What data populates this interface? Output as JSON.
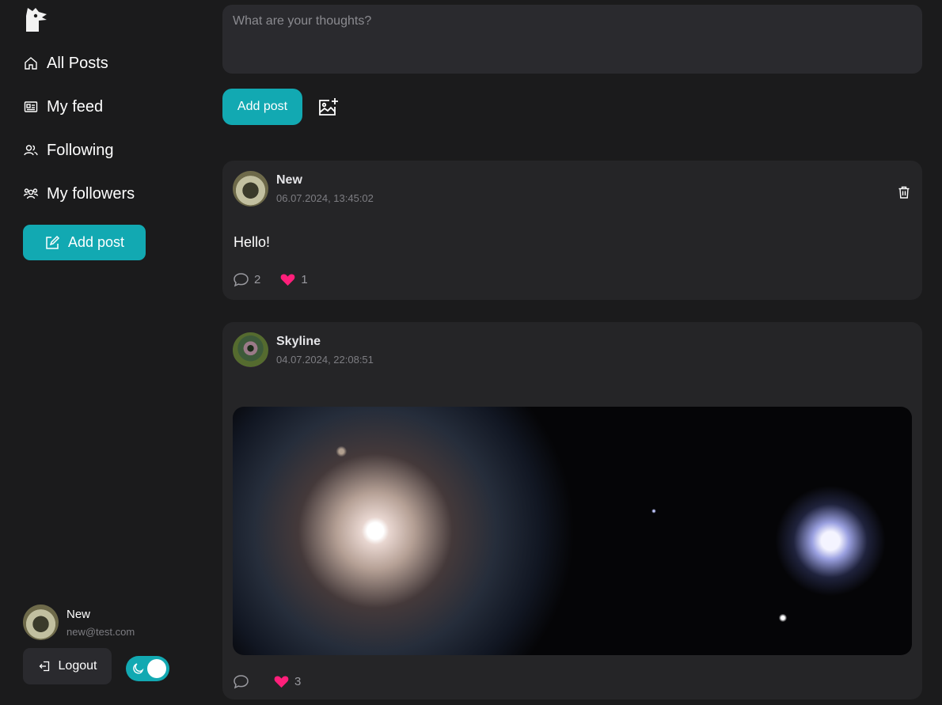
{
  "sidebar": {
    "nav": [
      {
        "label": "All Posts",
        "icon": "home-icon"
      },
      {
        "label": "My feed",
        "icon": "feed-icon"
      },
      {
        "label": "Following",
        "icon": "users-icon"
      },
      {
        "label": "My followers",
        "icon": "followers-icon"
      }
    ],
    "add_post_label": "Add post",
    "user": {
      "name": "New",
      "email": "new@test.com"
    },
    "logout_label": "Logout",
    "theme": "dark"
  },
  "composer": {
    "placeholder": "What are your thoughts?",
    "add_post_label": "Add post"
  },
  "posts": [
    {
      "author": "New",
      "date": "06.07.2024, 13:45:02",
      "text": "Hello!",
      "comments": "2",
      "likes": "1",
      "has_image": false,
      "deletable": true
    },
    {
      "author": "Skyline",
      "date": "04.07.2024, 22:08:51",
      "text": "",
      "comments": "",
      "likes": "3",
      "has_image": true,
      "deletable": false
    }
  ],
  "colors": {
    "accent": "#12a9b2",
    "background": "#1b1b1c",
    "card": "#252527",
    "like": "#ff1f7a"
  }
}
